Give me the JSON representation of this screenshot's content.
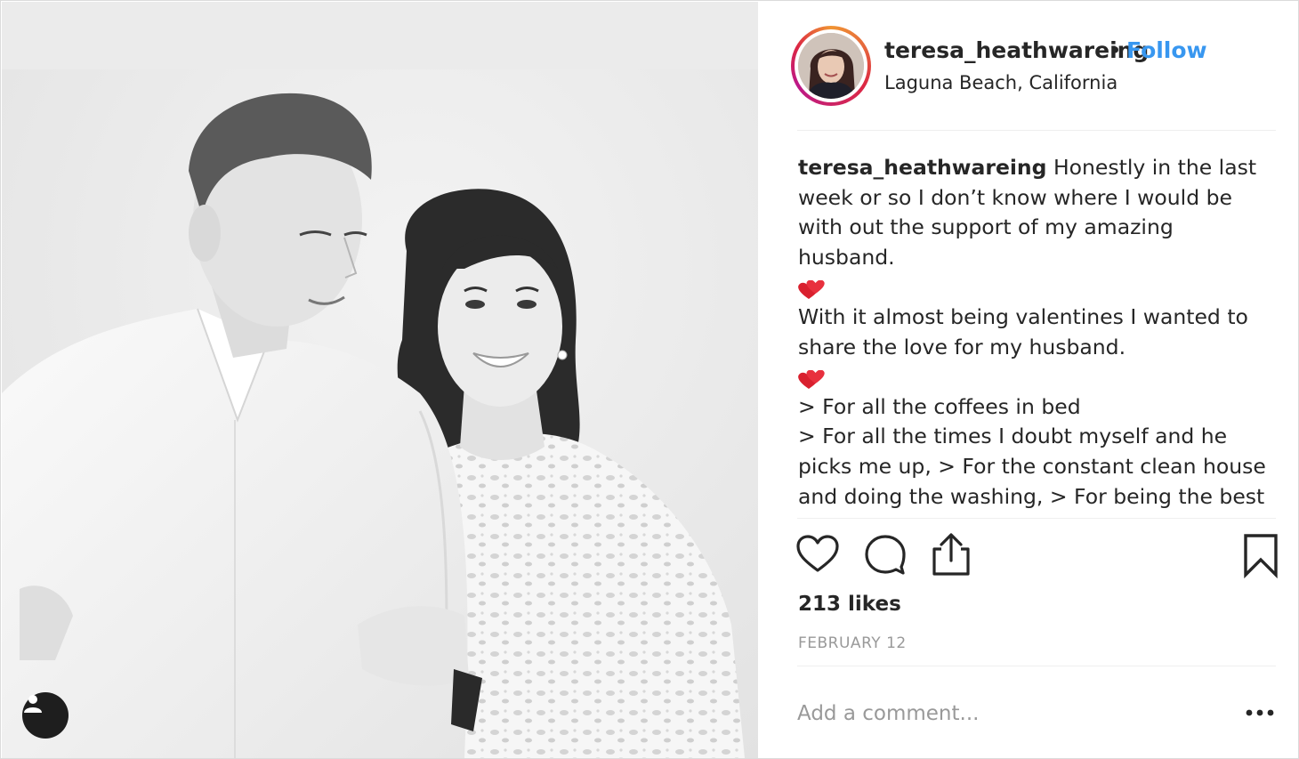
{
  "post": {
    "username": "teresa_heathwareing",
    "separator": "•",
    "follow_label": "Follow",
    "location": "Laguna Beach, California"
  },
  "caption": {
    "username": "teresa_heathwareing",
    "lines": [
      " Honestly in the last",
      "week or so I don’t know where I would be",
      "with out the support of my amazing",
      "husband.",
      "With it almost being valentines I wanted to",
      "share the love for my husband.",
      "> For all the coffees in bed",
      "> For all the times I doubt myself and he",
      "picks me up, > For the constant clean house",
      "and doing the washing, > For being the best"
    ],
    "emoji_icon": "two-hearts-icon"
  },
  "actions": {
    "like_icon": "heart-icon",
    "comment_icon": "comment-icon",
    "share_icon": "share-icon",
    "save_icon": "bookmark-icon"
  },
  "likes_text": "213 likes",
  "date_text": "FEBRUARY 12",
  "comment": {
    "placeholder": "Add a comment...",
    "more_icon": "more-options-icon"
  },
  "photo": {
    "tag_icon": "user-tag-icon"
  },
  "colors": {
    "accent": "#3897f0",
    "text": "#262626",
    "muted": "#999999",
    "border": "#dbdbdb"
  }
}
